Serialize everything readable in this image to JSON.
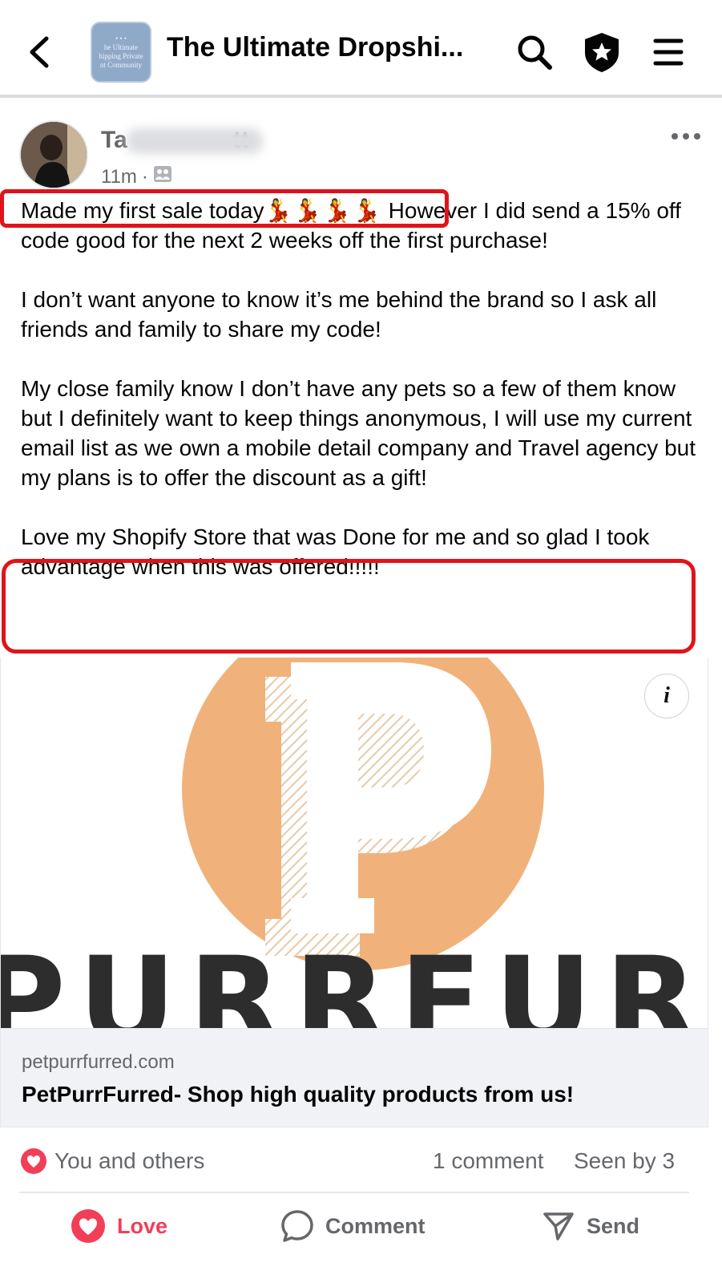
{
  "header": {
    "title": "The Ultimate Dropshi...",
    "group_thumb_lines": [
      "• • •",
      "he Ultimate",
      "hipping Private",
      "nt Community"
    ]
  },
  "post": {
    "author_visible": "Ta",
    "author_tail": "tt",
    "time": "11m",
    "dot": "·",
    "paragraph_1_start": "Made my first sale today",
    "paragraph_1_emoji": "💃💃💃💃",
    "paragraph_1_rest": " However I did send a 15% off code good for the next 2 weeks off the first purchase!",
    "paragraph_2": "I don’t want anyone to know it’s me behind the brand so I ask all friends  and family to share my code!",
    "paragraph_3": "My close family know I don’t have any pets so a few of them know but I definitely want to keep things anonymous, I will use my current email list as we own a mobile detail company and Travel agency but my plans is to offer the discount as a gift!",
    "paragraph_4": "Love my Shopify Store that was Done for me and so glad I took advantage when this was offered!!!!!"
  },
  "link_preview": {
    "logo_letter": "P",
    "brand_wordmark": "PETPURRFURRED",
    "info_label": "i",
    "domain": "petpurrfurred.com",
    "title": "PetPurrFurred- Shop high quality products from us!"
  },
  "reactions": {
    "reactors": "You and others",
    "comments": "1 comment",
    "seen_by": "Seen by 3"
  },
  "actions": {
    "love": "Love",
    "comment": "Comment",
    "send": "Send"
  },
  "colors": {
    "love_red": "#f33e58",
    "highlight_red": "#e1131a",
    "logo_orange": "#f0b27a",
    "muted_text": "#65676b"
  }
}
